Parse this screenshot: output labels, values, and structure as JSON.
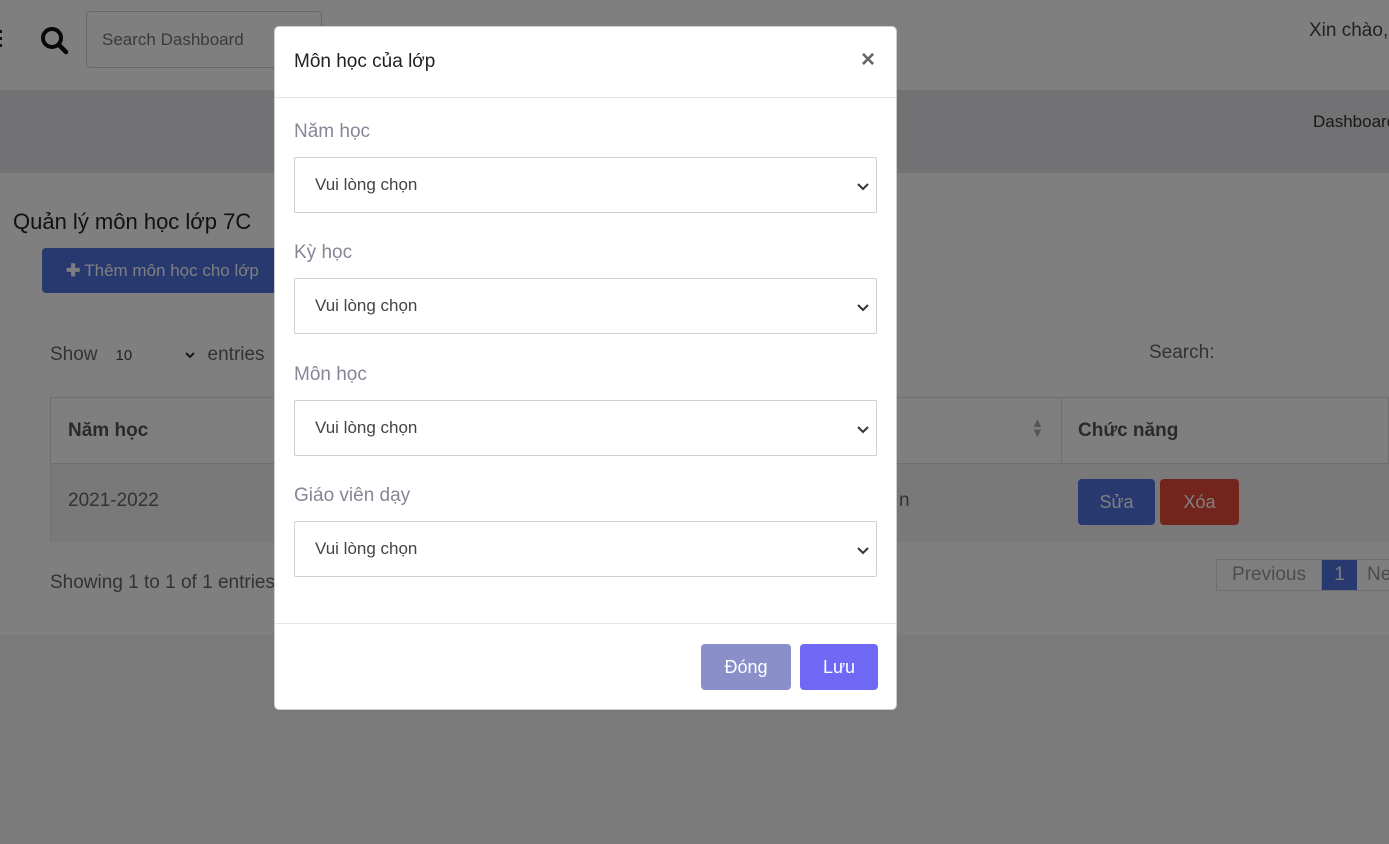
{
  "topbar": {
    "search_placeholder": "Search Dashboard",
    "greeting": "Xin chào,"
  },
  "breadcrumb": {
    "current": "Dashboard"
  },
  "page": {
    "title": "Quản lý môn học lớp 7C",
    "add_button": "Thêm môn học cho lớp"
  },
  "table_controls": {
    "show_label": "Show",
    "entries_value": "10",
    "entries_label": "entries",
    "search_label": "Search:"
  },
  "table": {
    "headers": [
      "Năm học",
      "Chức năng"
    ],
    "rows": [
      {
        "nam_hoc": "2021-2022",
        "partial_cell": "n",
        "edit_label": "Sửa",
        "delete_label": "Xóa"
      }
    ]
  },
  "footer_info": {
    "showing": "Showing 1 to 1 of 1 entries"
  },
  "pagination": {
    "previous": "Previous",
    "current": "1",
    "next": "Next"
  },
  "modal": {
    "title": "Môn học của lớp",
    "close_symbol": "×",
    "fields": [
      {
        "label": "Năm học",
        "value": "Vui lòng chọn"
      },
      {
        "label": "Kỳ học",
        "value": "Vui lòng chọn"
      },
      {
        "label": "Môn học",
        "value": "Vui lòng chọn"
      },
      {
        "label": "Giáo viên dạy",
        "value": "Vui lòng chọn"
      }
    ],
    "close_button": "Đóng",
    "save_button": "Lưu"
  },
  "colors": {
    "primary": "#4e73df",
    "danger": "#e74a3b",
    "modal_save": "#6f68f5",
    "modal_close": "#8a8fc9"
  },
  "icons": [
    "menu-icon",
    "search-icon",
    "plus-icon",
    "sort-icon",
    "close-icon",
    "chevron-down-icon"
  ]
}
